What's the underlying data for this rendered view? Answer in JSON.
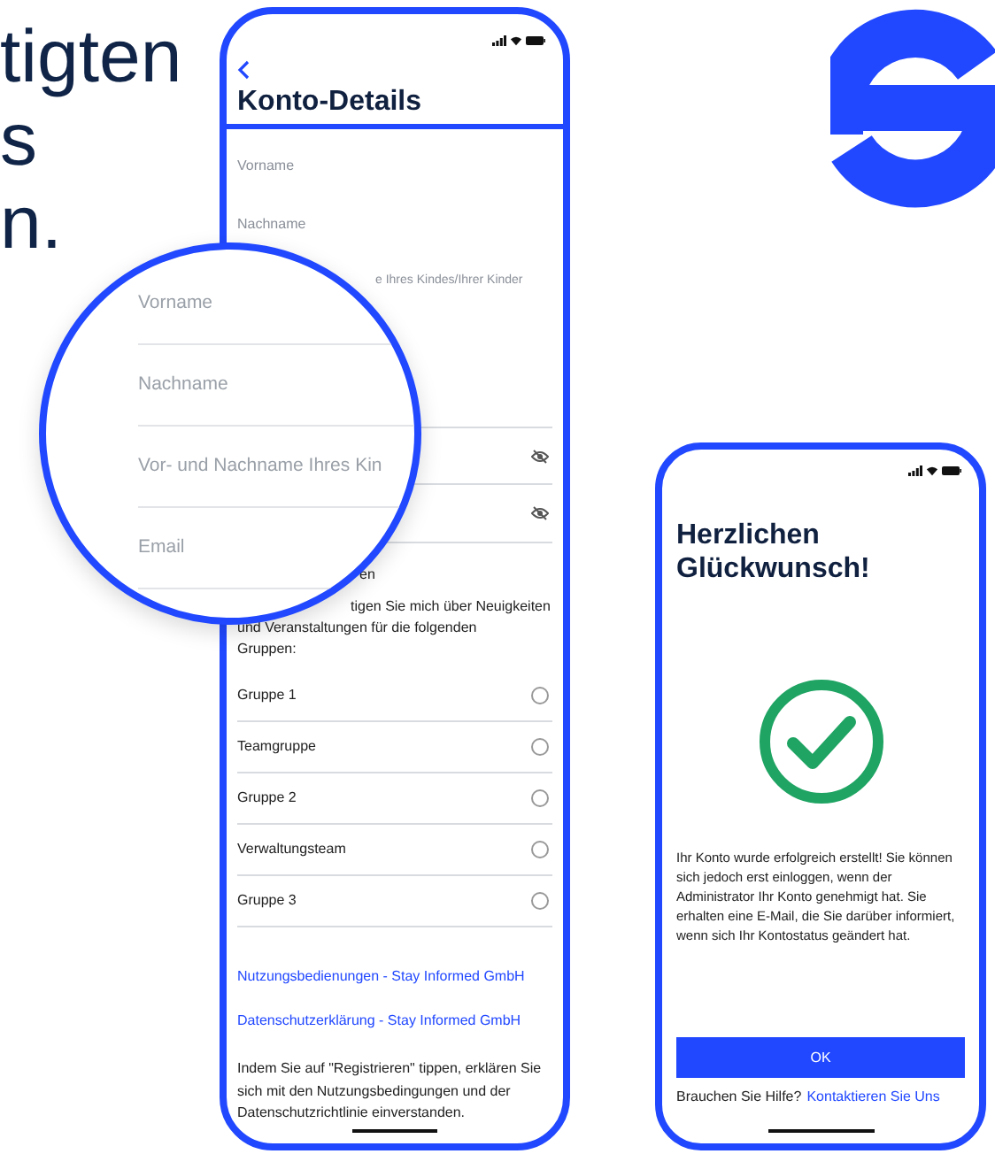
{
  "headline_fragments": [
    "tigten",
    "s",
    "n."
  ],
  "account_screen": {
    "title": "Konto-Details",
    "fields": [
      {
        "kind": "text",
        "label": "Vorname"
      },
      {
        "kind": "text",
        "label": "Nachname"
      },
      {
        "kind": "text",
        "label": "e Ihres Kindes/Ihrer Kinder"
      },
      {
        "kind": "password"
      },
      {
        "kind": "password"
      }
    ],
    "consent_heading_fragment": "en",
    "consent_line_fragment": "tigen Sie mich über Neuigkeiten",
    "consent_text": "und Veranstaltungen für die folgenden Gruppen:",
    "groups": [
      {
        "label": "Gruppe 1",
        "selected": false
      },
      {
        "label": "Teamgruppe",
        "selected": false
      },
      {
        "label": "Gruppe 2",
        "selected": false
      },
      {
        "label": "Verwaltungsteam",
        "selected": false
      },
      {
        "label": "Gruppe 3",
        "selected": false
      }
    ],
    "links": [
      "Nutzungsbedienungen - Stay Informed GmbH",
      "Datenschutzerklärung - Stay Informed GmbH"
    ],
    "terms_note": "Indem Sie auf \"Registrieren\" tippen, erklären Sie sich mit den Nutzungsbedingungen und der Datenschutzrichtlinie einverstanden."
  },
  "magnifier": {
    "fields": [
      "Vorname",
      "Nachname",
      "Vor- und Nachname Ihres Kin",
      "Email"
    ]
  },
  "success_screen": {
    "title": "Herzlichen Glückwunsch!",
    "message": "Ihr Konto wurde erfolgreich erstellt! Sie können sich jedoch erst einloggen, wenn der Administrator Ihr Konto genehmigt hat. Sie erhalten eine E-Mail, die Sie darüber informiert, wenn sich Ihr Kontostatus geändert hat.",
    "button": "OK",
    "help_text": "Brauchen Sie Hilfe?",
    "help_link": "Kontaktieren Sie Uns"
  }
}
